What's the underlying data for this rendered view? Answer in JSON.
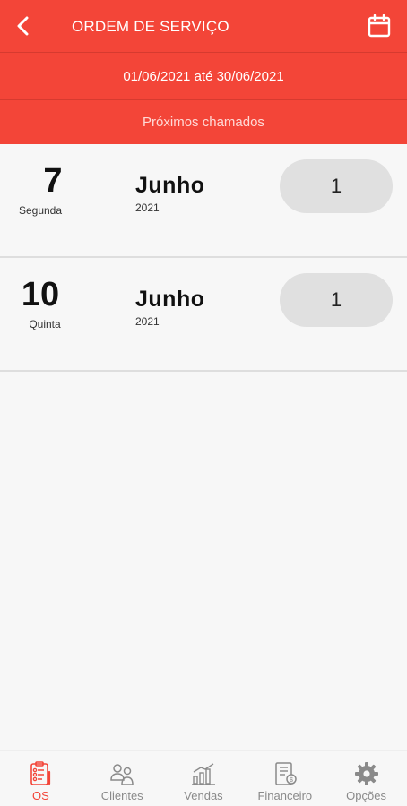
{
  "header": {
    "title": "ORDEM DE SERVIÇO",
    "date_range": "01/06/2021 até 30/06/2021",
    "subtitle": "Próximos chamados"
  },
  "rows": [
    {
      "day": "7",
      "weekday": "Segunda",
      "month": "Junho",
      "year": "2021",
      "count": "1"
    },
    {
      "day": "10",
      "weekday": "Quinta",
      "month": "Junho",
      "year": "2021",
      "count": "1"
    }
  ],
  "nav": {
    "items": [
      {
        "label": "OS",
        "icon": "clipboard-checklist-icon",
        "active": true
      },
      {
        "label": "Clientes",
        "icon": "people-icon",
        "active": false
      },
      {
        "label": "Vendas",
        "icon": "sales-chart-icon",
        "active": false
      },
      {
        "label": "Financeiro",
        "icon": "finance-document-icon",
        "active": false
      },
      {
        "label": "Opções",
        "icon": "gear-icon",
        "active": false
      }
    ]
  },
  "colors": {
    "primary": "#f34538",
    "inactive": "#8a8a8a",
    "pill": "#e0e0e0"
  }
}
